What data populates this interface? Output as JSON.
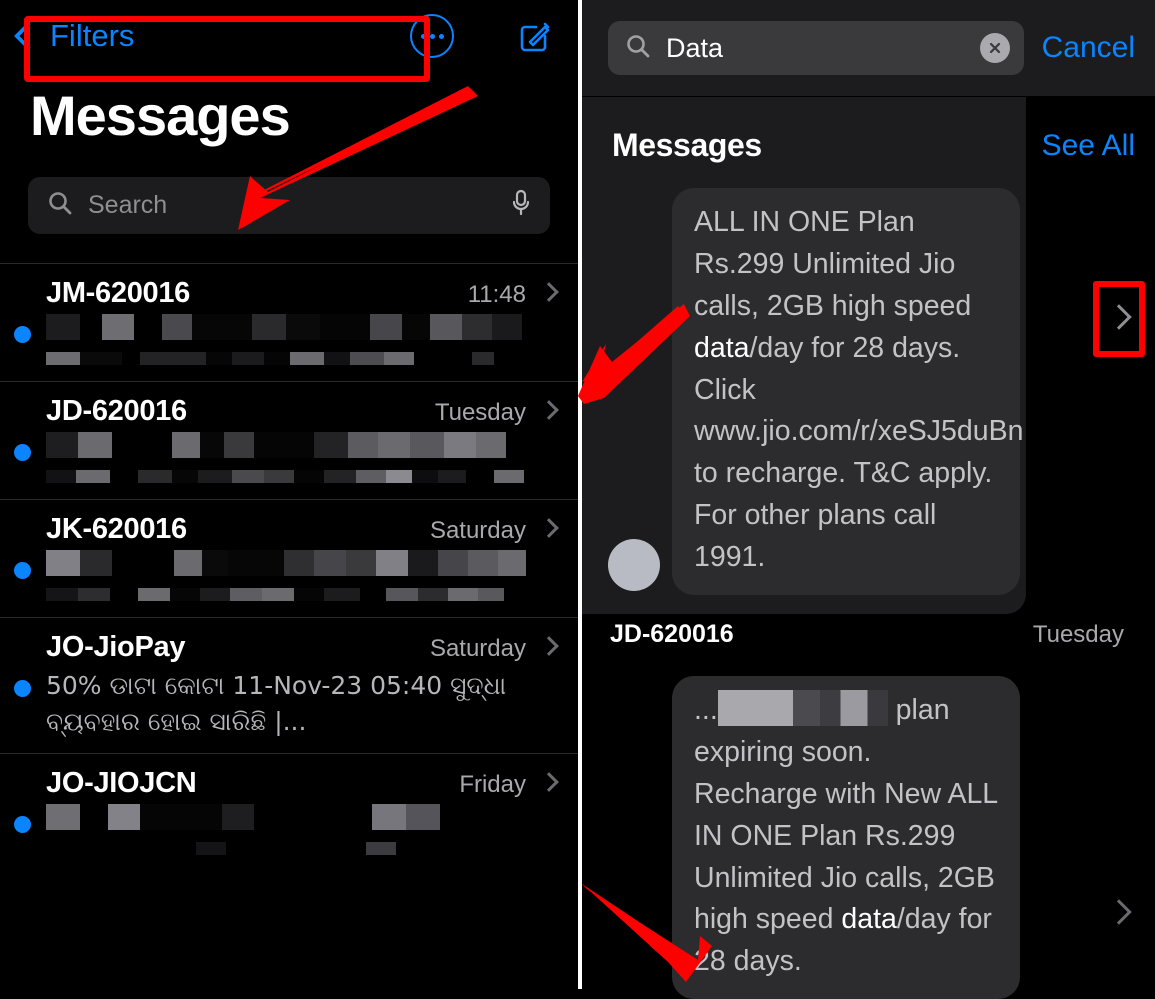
{
  "left": {
    "nav": {
      "back_label": "Filters",
      "more_icon": "ellipsis-circle-icon",
      "compose_icon": "compose-icon"
    },
    "title": "Messages",
    "search": {
      "placeholder": "Search",
      "icon": "search-icon",
      "mic_icon": "microphone-icon"
    },
    "conversations": [
      {
        "sender": "JM-620016",
        "time": "11:48",
        "preview": "",
        "redacted": true,
        "unread": true
      },
      {
        "sender": "JD-620016",
        "time": "Tuesday",
        "preview": "",
        "redacted": true,
        "unread": true
      },
      {
        "sender": "JK-620016",
        "time": "Saturday",
        "preview": "",
        "redacted": true,
        "unread": true
      },
      {
        "sender": "JO-JioPay",
        "time": "Saturday",
        "preview": "50% ଡାଟା କୋଟା 11-Nov-23 05:40 ସୁଦ୍ଧା ବ୍ୟବହାର ହୋଇ ସାରିଛି |...",
        "redacted": false,
        "unread": true
      },
      {
        "sender": "JO-JIOJCN",
        "time": "Friday",
        "preview": "",
        "redacted": true,
        "unread": true
      }
    ]
  },
  "right": {
    "search": {
      "value": "Data",
      "icon": "search-icon",
      "clear_icon": "clear-x-icon",
      "cancel_label": "Cancel"
    },
    "section": {
      "title": "Messages",
      "see_all_label": "See All"
    },
    "results": [
      {
        "body_prefix": "ALL IN ONE Plan Rs.299 Unlimited Jio calls, 2GB high speed ",
        "highlight": "data",
        "body_suffix": "/day for 28 days. Click www.jio.com/r/xeSJ5duBn to recharge. T&C apply. For other plans call 1991.",
        "has_avatar": true
      },
      {
        "sender": "JD-620016",
        "time": "Tuesday",
        "body_prefix_redacted": "...",
        "body_prefix": " plan expiring soon. Recharge with New ALL IN ONE Plan Rs.299 Unlimited Jio calls, 2GB high speed ",
        "highlight": "data",
        "body_suffix": "/day for 28 days.",
        "has_avatar": false
      }
    ]
  },
  "annotations": {
    "accent_blue": "#0a84ff",
    "highlight_red": "#ff0000",
    "arrows": [
      {
        "name": "arrow-to-search-bar",
        "target": "left search bar"
      },
      {
        "name": "arrow-to-data-match-1",
        "target": "data keyword in first result"
      },
      {
        "name": "arrow-to-data-match-2",
        "target": "data keyword in second result"
      }
    ],
    "boxes": [
      {
        "name": "red-box-search-field",
        "target": "search input with Data"
      },
      {
        "name": "red-box-result-chevron",
        "target": "result disclosure chevron"
      }
    ]
  }
}
